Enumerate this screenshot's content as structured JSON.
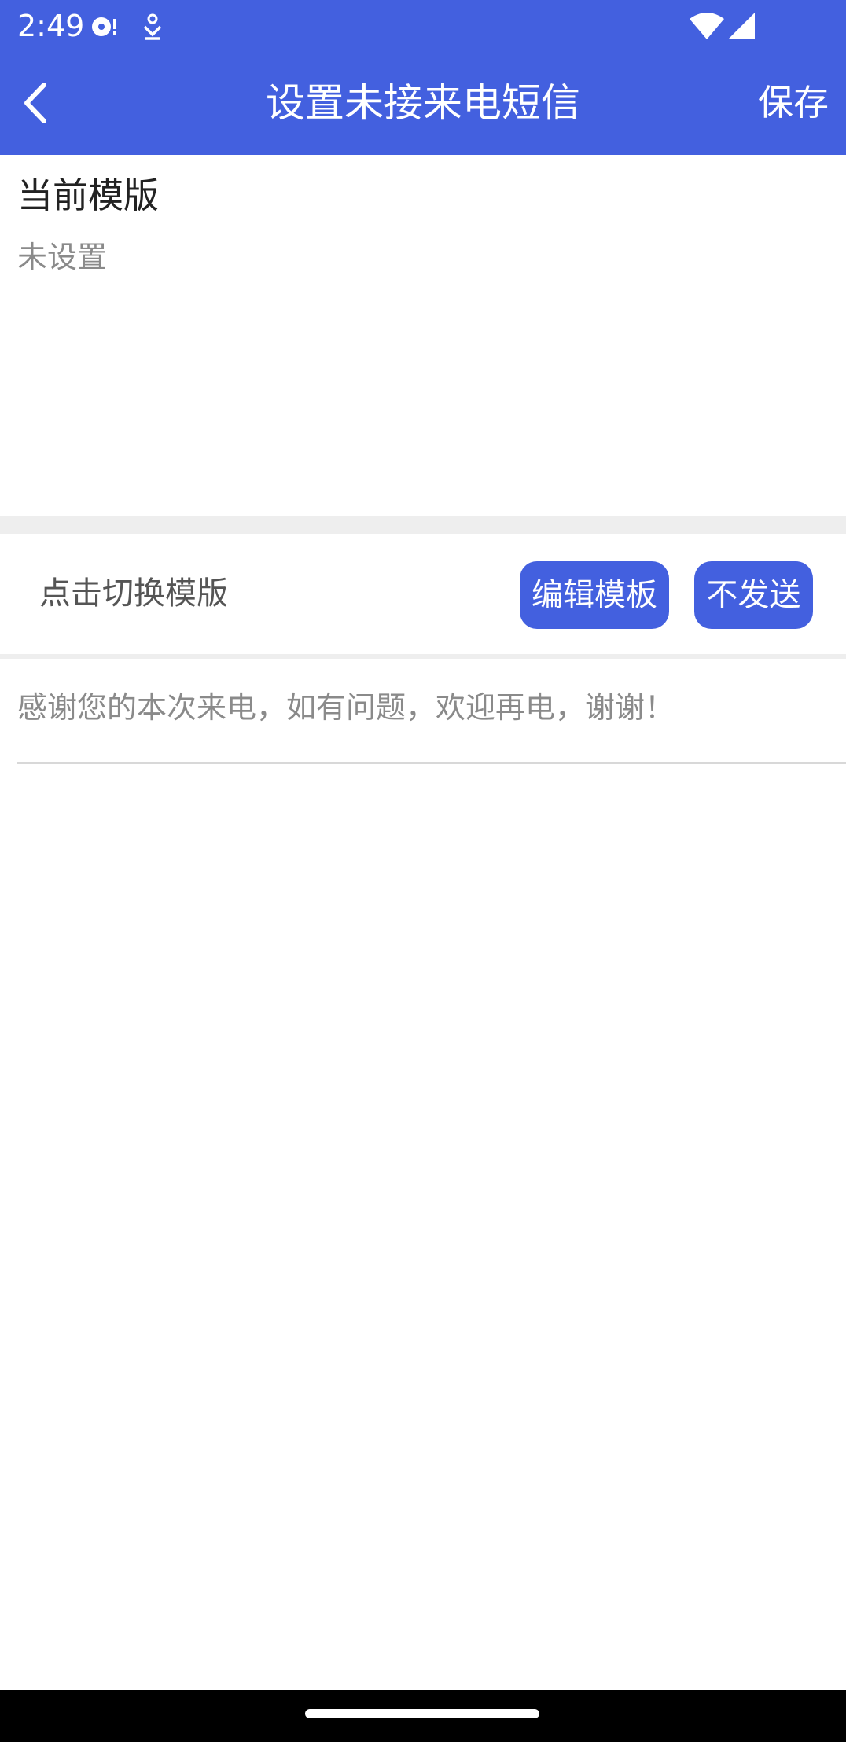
{
  "status_bar": {
    "time": "2:49",
    "icons": [
      "media-notification-icon",
      "download-notification-icon",
      "wifi-icon",
      "cellular-signal-icon"
    ]
  },
  "app_bar": {
    "back_icon": "chevron-left-icon",
    "title": "设置未接来电短信",
    "save_label": "保存"
  },
  "current_template": {
    "label": "当前模版",
    "value": "未设置"
  },
  "switch_row": {
    "label": "点击切换模版",
    "edit_button_label": "编辑模板",
    "no_send_button_label": "不发送"
  },
  "message": {
    "text": "感谢您的本次来电，如有问题，欢迎再电，谢谢！"
  },
  "colors": {
    "primary": "#4360DF",
    "background": "#FFFFFF",
    "divider": "#EEEEEE",
    "secondary_text": "#8A8A8A"
  }
}
